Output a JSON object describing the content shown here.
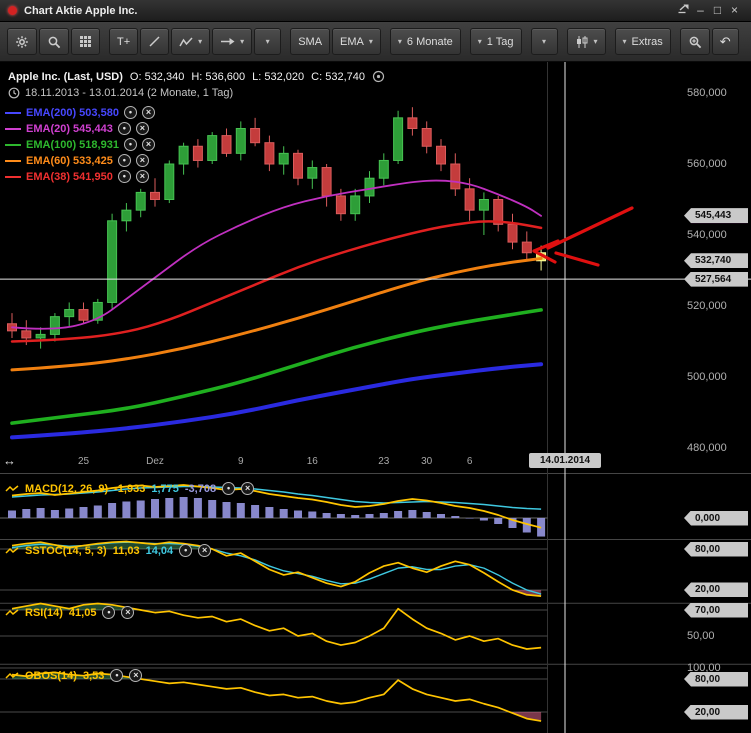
{
  "window": {
    "title": "Chart Aktie Apple Inc.",
    "controls": [
      {
        "name": "popout-button",
        "icon": "popout-icon"
      },
      {
        "name": "minimize-button",
        "glyph": "–"
      },
      {
        "name": "maximize-button",
        "glyph": "□"
      },
      {
        "name": "close-button",
        "glyph": "×"
      }
    ]
  },
  "icons": {
    "chevron-down-icon": "▾",
    "undo-icon": "↶",
    "resize-horizontal-icon": "↔"
  },
  "toolbar": {
    "groups": [
      {
        "items": [
          {
            "name": "settings-button",
            "icon": "gear-icon"
          },
          {
            "name": "search-button",
            "icon": "search-icon"
          },
          {
            "name": "layout-grid-button",
            "icon": "grid-icon"
          }
        ]
      },
      {
        "items": [
          {
            "name": "text-tool-button",
            "label": "T+"
          },
          {
            "name": "line-tool-button",
            "icon": "line-tool-icon"
          },
          {
            "name": "zigzag-tool-button",
            "icon": "zigzag-icon",
            "chevron": true
          },
          {
            "name": "arrow-tool-button",
            "icon": "arrow-tool-icon",
            "chevron": true
          },
          {
            "name": "drawing-tools-dropdown",
            "chevron": true
          }
        ]
      },
      {
        "items": [
          {
            "name": "sma-button",
            "label": "SMA"
          },
          {
            "name": "ema-button",
            "label": "EMA",
            "chevron": true
          }
        ]
      },
      {
        "items": [
          {
            "name": "timeframe-select",
            "label": "6 Monate",
            "chevron_left": true
          }
        ]
      },
      {
        "items": [
          {
            "name": "interval-select",
            "label": "1 Tag",
            "chevron_left": true
          }
        ]
      },
      {
        "items": [
          {
            "name": "period-dropdown",
            "chevron_left": true
          }
        ]
      },
      {
        "items": [
          {
            "name": "chart-type-select",
            "icon": "candle-icon",
            "chevron": true
          }
        ]
      },
      {
        "items": [
          {
            "name": "extras-select",
            "label": "Extras",
            "chevron_left": true
          }
        ]
      },
      {
        "items": [
          {
            "name": "zoom-button",
            "icon": "zoom-icon"
          },
          {
            "name": "undo-button",
            "glyph": "↶"
          }
        ]
      }
    ],
    "right_items": [
      {
        "name": "compare-button",
        "icon": "compare-icon"
      },
      {
        "name": "indicator-list-button",
        "icon": "sparkline-icon"
      }
    ]
  },
  "header": {
    "name": "Apple Inc. (Last, USD)",
    "fields": [
      {
        "label": "O:",
        "value": "532,340"
      },
      {
        "label": "H:",
        "value": "536,600"
      },
      {
        "label": "L:",
        "value": "532,020"
      },
      {
        "label": "C:",
        "value": "532,740"
      }
    ],
    "range": "18.11.2013 - 13.01.2014 (2 Monate, 1 Tag)"
  },
  "legend": {
    "items": [
      {
        "label": "EMA(200) 503,580",
        "color": "#4747ff"
      },
      {
        "label": "EMA(20) 545,443",
        "color": "#d040d0"
      },
      {
        "label": "EMA(100) 518,931",
        "color": "#2eb82e"
      },
      {
        "label": "EMA(60) 533,425",
        "color": "#ff8c1a"
      },
      {
        "label": "EMA(38) 541,950",
        "color": "#f03030"
      }
    ]
  },
  "chart_data": {
    "type": "candlestick",
    "title": "Apple Inc. (Last, USD)",
    "unit": "USD, values in thousands",
    "ylim": [
      480,
      580
    ],
    "x_ticks": [
      {
        "label": "25",
        "i": 5
      },
      {
        "label": "Dez",
        "i": 10
      },
      {
        "label": "9",
        "i": 16
      },
      {
        "label": "16",
        "i": 21
      },
      {
        "label": "23",
        "i": 26
      },
      {
        "label": "30",
        "i": 29
      },
      {
        "label": "6",
        "i": 32
      }
    ],
    "crosshair": {
      "x": 565,
      "date_label": "14.01.2014",
      "price_label": "527,564",
      "price": 527.564
    },
    "price_axis": {
      "labels": [
        {
          "text": "580,000",
          "value": 580
        },
        {
          "text": "560,000",
          "value": 560
        },
        {
          "text": "540,000",
          "value": 540
        },
        {
          "text": "520,000",
          "value": 520
        },
        {
          "text": "500,000",
          "value": 500
        },
        {
          "text": "480,000",
          "value": 480
        }
      ],
      "tags": [
        {
          "text": "545,443",
          "value": 545.443,
          "mag": true
        },
        {
          "text": "532,740",
          "value": 532.74
        },
        {
          "text": "527,564",
          "value": 527.564
        }
      ]
    },
    "candles": {
      "ohlc": [
        [
          515,
          518,
          511,
          513
        ],
        [
          513,
          516,
          509,
          511
        ],
        [
          511,
          514,
          508,
          512
        ],
        [
          512,
          518,
          510,
          517
        ],
        [
          517,
          521,
          514,
          519
        ],
        [
          519,
          521,
          515,
          516
        ],
        [
          516,
          522,
          515,
          521
        ],
        [
          521,
          546,
          519,
          544
        ],
        [
          544,
          549,
          541,
          547
        ],
        [
          547,
          553,
          545,
          552
        ],
        [
          552,
          556,
          548,
          550
        ],
        [
          550,
          561,
          549,
          560
        ],
        [
          560,
          566,
          557,
          565
        ],
        [
          565,
          567,
          559,
          561
        ],
        [
          561,
          569,
          560,
          568
        ],
        [
          568,
          570,
          562,
          563
        ],
        [
          563,
          572,
          561,
          570
        ],
        [
          570,
          573,
          565,
          566
        ],
        [
          566,
          568,
          558,
          560
        ],
        [
          560,
          565,
          557,
          563
        ],
        [
          563,
          564,
          554,
          556
        ],
        [
          556,
          561,
          553,
          559
        ],
        [
          559,
          560,
          548,
          551
        ],
        [
          551,
          553,
          544,
          546
        ],
        [
          546,
          553,
          544,
          551
        ],
        [
          551,
          558,
          549,
          556
        ],
        [
          556,
          563,
          554,
          561
        ],
        [
          561,
          575,
          560,
          573
        ],
        [
          573,
          576,
          568,
          570
        ],
        [
          570,
          572,
          563,
          565
        ],
        [
          565,
          567,
          558,
          560
        ],
        [
          560,
          563,
          551,
          553
        ],
        [
          553,
          556,
          544,
          547
        ],
        [
          547,
          552,
          540,
          550
        ],
        [
          550,
          551,
          541,
          543
        ],
        [
          543,
          546,
          536,
          538
        ],
        [
          538,
          541,
          533,
          535
        ],
        [
          535,
          537,
          530,
          532.74
        ]
      ]
    },
    "overlays": [
      {
        "name": "EMA(200)",
        "value": "503,580",
        "color": "#2a2ae0",
        "width": 4,
        "points": [
          [
            0,
            483
          ],
          [
            4,
            484
          ],
          [
            8,
            485.5
          ],
          [
            12,
            487.5
          ],
          [
            16,
            490
          ],
          [
            20,
            493.5
          ],
          [
            24,
            496.5
          ],
          [
            28,
            499.5
          ],
          [
            31,
            501
          ],
          [
            34,
            502.5
          ],
          [
            37,
            503.6
          ]
        ]
      },
      {
        "name": "EMA(20)",
        "value": "545,443",
        "color": "#c030c0",
        "width": 1.8,
        "points": [
          [
            0,
            514
          ],
          [
            3,
            513
          ],
          [
            6,
            516
          ],
          [
            8,
            522
          ],
          [
            10,
            528
          ],
          [
            13,
            537
          ],
          [
            16,
            543
          ],
          [
            19,
            548
          ],
          [
            22,
            551
          ],
          [
            25,
            553
          ],
          [
            28,
            555
          ],
          [
            30,
            555.5
          ],
          [
            32,
            554.5
          ],
          [
            34,
            551.5
          ],
          [
            36,
            548
          ],
          [
            37,
            545.4
          ]
        ]
      },
      {
        "name": "EMA(100)",
        "value": "518,931",
        "color": "#1faf1f",
        "width": 3.6,
        "points": [
          [
            0,
            487
          ],
          [
            4,
            489
          ],
          [
            8,
            491
          ],
          [
            12,
            494.5
          ],
          [
            16,
            498.5
          ],
          [
            20,
            503.5
          ],
          [
            24,
            508.5
          ],
          [
            28,
            512.5
          ],
          [
            31,
            515
          ],
          [
            34,
            517
          ],
          [
            37,
            518.9
          ]
        ]
      },
      {
        "name": "EMA(60)",
        "value": "533,425",
        "color": "#f08010",
        "width": 3,
        "points": [
          [
            0,
            502
          ],
          [
            4,
            503
          ],
          [
            8,
            505
          ],
          [
            12,
            508
          ],
          [
            16,
            512
          ],
          [
            20,
            516.5
          ],
          [
            24,
            521.5
          ],
          [
            28,
            526.5
          ],
          [
            31,
            529.5
          ],
          [
            34,
            531.8
          ],
          [
            37,
            533.4
          ]
        ]
      },
      {
        "name": "EMA(38)",
        "value": "541,950",
        "color": "#e02020",
        "width": 2.5,
        "points": [
          [
            0,
            510
          ],
          [
            4,
            510.5
          ],
          [
            8,
            512.5
          ],
          [
            11,
            516
          ],
          [
            14,
            521
          ],
          [
            17,
            526
          ],
          [
            20,
            531
          ],
          [
            23,
            535
          ],
          [
            26,
            538.5
          ],
          [
            29,
            541.5
          ],
          [
            31,
            543
          ],
          [
            33,
            544
          ],
          [
            35,
            543.5
          ],
          [
            37,
            542
          ]
        ]
      }
    ],
    "indicator_panels": [
      {
        "id": "macd",
        "label": "MACD(12, 26, 9)",
        "values": [
          {
            "text": "-1,933",
            "color": "#ffc400"
          },
          {
            "text": "1,775",
            "color": "#3fc8e0"
          },
          {
            "text": "-3,708",
            "color": "#9a9ae0"
          }
        ],
        "axis": [
          {
            "text": "0,000",
            "value": 0,
            "tag": true
          }
        ],
        "series": {
          "macd": [
            4.5,
            4.8,
            5.0,
            4.6,
            4.9,
            5.2,
            5.5,
            6.0,
            6.3,
            6.5,
            6.2,
            6.4,
            6.6,
            6.3,
            6.0,
            5.6,
            5.8,
            5.4,
            4.8,
            4.4,
            4.0,
            3.7,
            3.2,
            2.6,
            2.2,
            2.4,
            2.8,
            3.4,
            3.8,
            3.5,
            3.0,
            2.4,
            2.0,
            1.4,
            0.6,
            -0.4,
            -1.2,
            -1.933
          ],
          "signal": [
            4.2,
            4.4,
            4.6,
            4.7,
            4.8,
            5.0,
            5.2,
            5.5,
            5.8,
            6.0,
            6.1,
            6.2,
            6.3,
            6.3,
            6.2,
            6.1,
            6.0,
            5.8,
            5.5,
            5.2,
            4.8,
            4.5,
            4.1,
            3.7,
            3.3,
            3.1,
            3.0,
            3.1,
            3.2,
            3.3,
            3.2,
            3.1,
            2.9,
            2.7,
            2.4,
            2.1,
            1.9,
            1.775
          ],
          "histogram": [
            1.5,
            1.8,
            2.0,
            1.6,
            1.9,
            2.2,
            2.5,
            3.0,
            3.3,
            3.5,
            3.8,
            4.0,
            4.2,
            4.0,
            3.6,
            3.2,
            3.0,
            2.6,
            2.2,
            1.8,
            1.5,
            1.3,
            1.0,
            0.8,
            0.6,
            0.8,
            1.0,
            1.4,
            1.6,
            1.2,
            0.8,
            0.4,
            0.0,
            -0.5,
            -1.2,
            -2.0,
            -2.9,
            -3.708
          ]
        }
      },
      {
        "id": "sstoc",
        "label": "SSTOC(14, 5, 3)",
        "values": [
          {
            "text": "11,03",
            "color": "#ffc400"
          },
          {
            "text": "14,04",
            "color": "#3fc8e0"
          }
        ],
        "axis": [
          {
            "text": "80,00",
            "value": 80,
            "tag": true
          },
          {
            "text": "20,00",
            "value": 20,
            "tag": true
          }
        ],
        "bands": {
          "upper": 80,
          "lower": 20
        },
        "series": {
          "k": [
            85,
            88,
            90,
            86,
            82,
            85,
            88,
            90,
            91,
            89,
            87,
            90,
            88,
            85,
            80,
            70,
            74,
            62,
            50,
            42,
            46,
            38,
            30,
            25,
            32,
            45,
            55,
            60,
            52,
            46,
            55,
            62,
            57,
            45,
            32,
            20,
            13,
            11.03
          ],
          "d": [
            82,
            85,
            87,
            86,
            84,
            85,
            87,
            89,
            90,
            89,
            88,
            88,
            87,
            84,
            80,
            74,
            70,
            64,
            55,
            48,
            44,
            40,
            34,
            29,
            30,
            36,
            44,
            52,
            54,
            50,
            50,
            55,
            57,
            52,
            42,
            30,
            20,
            14.04
          ]
        }
      },
      {
        "id": "rsi",
        "label": "RSI(14)",
        "values": [
          {
            "text": "41,05",
            "color": "#ffc400"
          }
        ],
        "axis": [
          {
            "text": "70,00",
            "value": 70,
            "tag": true
          },
          {
            "text": "50,00",
            "value": 50,
            "tag": false
          }
        ],
        "bands": {
          "upper": 70,
          "lower": 30
        },
        "series": {
          "line": [
            71,
            73,
            75,
            73,
            71,
            74,
            75,
            74,
            72,
            70,
            68,
            69,
            66,
            64,
            65,
            61,
            63,
            58,
            54,
            56,
            50,
            52,
            46,
            43,
            45,
            50,
            56,
            71,
            63,
            56,
            52,
            47,
            50,
            46,
            48,
            43,
            40,
            41.05
          ]
        }
      },
      {
        "id": "obos",
        "label": "OBOS(14)",
        "values": [
          {
            "text": "3,53",
            "color": "#ffc400"
          }
        ],
        "axis": [
          {
            "text": "100,00",
            "value": 100,
            "tag": false
          },
          {
            "text": "80,00",
            "value": 80,
            "tag": true
          },
          {
            "text": "20,00",
            "value": 20,
            "tag": true
          }
        ],
        "bands": {
          "upper": 80,
          "lower": 20
        },
        "series": {
          "line": [
            88,
            85,
            90,
            92,
            88,
            86,
            90,
            88,
            84,
            80,
            76,
            72,
            74,
            70,
            66,
            62,
            64,
            56,
            50,
            52,
            46,
            48,
            40,
            35,
            38,
            46,
            52,
            78,
            62,
            52,
            46,
            40,
            43,
            35,
            28,
            18,
            8,
            3.53
          ]
        }
      }
    ],
    "annotation_arrow_color": "#e01010"
  }
}
